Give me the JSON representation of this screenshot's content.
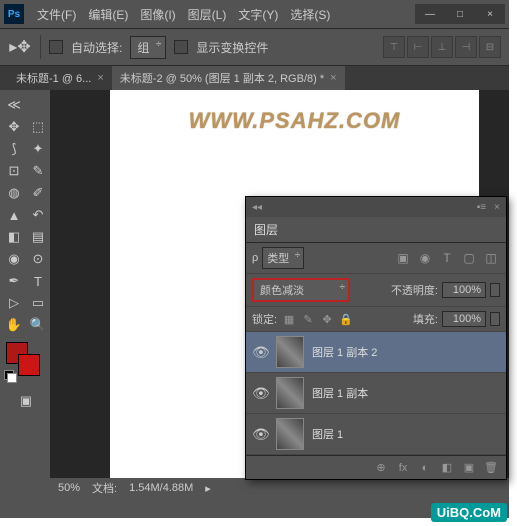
{
  "app_title": "Ps",
  "menu": [
    "文件(F)",
    "编辑(E)",
    "图像(I)",
    "图层(L)",
    "文字(Y)",
    "选择(S)"
  ],
  "window_controls": {
    "minimize": "—",
    "maximize": "□",
    "close": "×"
  },
  "options_bar": {
    "auto_select_label": "自动选择:",
    "group_value": "组",
    "show_transform_label": "显示变换控件"
  },
  "tabs": [
    {
      "label": "未标题-1 @ 6...",
      "active": false
    },
    {
      "label": "未标题-2 @ 50% (图层 1 副本 2, RGB/8) *",
      "active": true
    }
  ],
  "canvas": {
    "watermark_main": "WWW.PSAHZ.COM",
    "watermark_sub": "UiBQ.CoM"
  },
  "statusbar": {
    "zoom": "50%",
    "doc_label": "文档:",
    "doc_value": "1.54M/4.88M"
  },
  "layers_panel": {
    "title": "图层",
    "type_dd": "类型",
    "blend_mode": "颜色减淡",
    "opacity_label": "不透明度:",
    "opacity_value": "100%",
    "lock_label": "锁定:",
    "fill_label": "填充:",
    "fill_value": "100%",
    "filter_icons": [
      "▣",
      "◉",
      "T",
      "▢",
      "◫"
    ],
    "lock_icons": [
      "▦",
      "✎",
      "✥",
      "🔒"
    ],
    "layers": [
      {
        "name": "图层 1 副本 2",
        "selected": true
      },
      {
        "name": "图层 1 副本",
        "selected": false
      },
      {
        "name": "图层 1",
        "selected": false
      }
    ],
    "footer_icons": [
      "⊕",
      "fx",
      "◐",
      "◧",
      "▣",
      "🗑"
    ]
  }
}
